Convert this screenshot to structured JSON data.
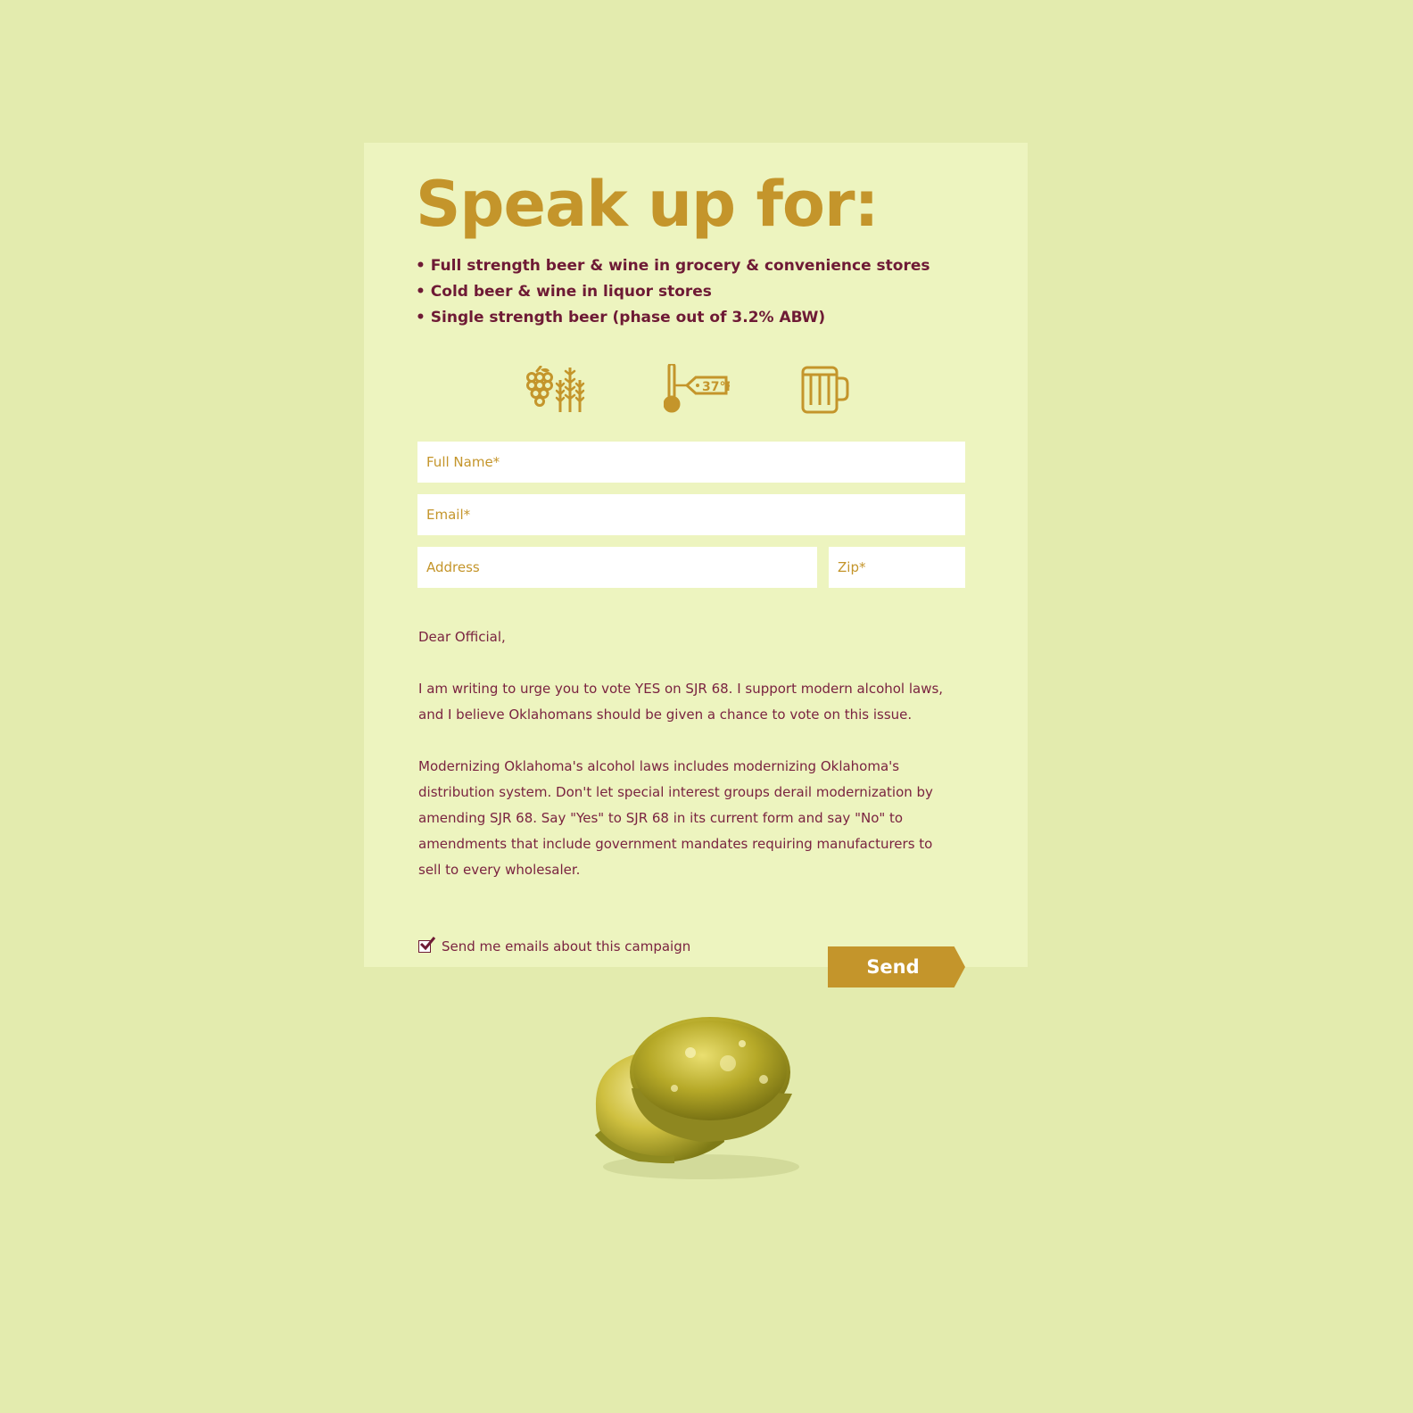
{
  "colors": {
    "page_background": "#e3ebae",
    "card_background": "#edf4bf",
    "accent_gold": "#c4952b",
    "text_maroon": "#6e1a35"
  },
  "heading": "Speak up for:",
  "bullets": [
    "• Full strength beer & wine in grocery & convenience stores",
    "• Cold beer & wine in liquor stores",
    "• Single strength beer (phase out of 3.2% ABW)"
  ],
  "icons": {
    "grapes_wheat": "grapes-wheat-icon",
    "thermometer": "thermometer-icon",
    "thermometer_tag": "37°F",
    "beer_mug": "beer-mug-icon"
  },
  "form": {
    "full_name_placeholder": "Full Name*",
    "email_placeholder": "Email*",
    "address_placeholder": "Address",
    "zip_placeholder": "Zip*"
  },
  "letter": {
    "greeting": "Dear Official,",
    "paragraph1": "I am writing to urge you to vote YES on SJR 68. I support modern alcohol laws, and I believe Oklahomans should be given a chance to vote on this issue.",
    "paragraph2": "Modernizing Oklahoma's alcohol laws includes modernizing Oklahoma's distribution system.  Don't let special interest groups derail modernization by amending SJR 68. Say \"Yes\" to SJR 68 in its current form and say \"No\" to amendments that include government mandates requiring manufacturers to sell to every wholesaler."
  },
  "consent": {
    "label": "Send me emails about this campaign",
    "checked": true
  },
  "send_label": "Send",
  "decoration": "bottle-caps-image"
}
